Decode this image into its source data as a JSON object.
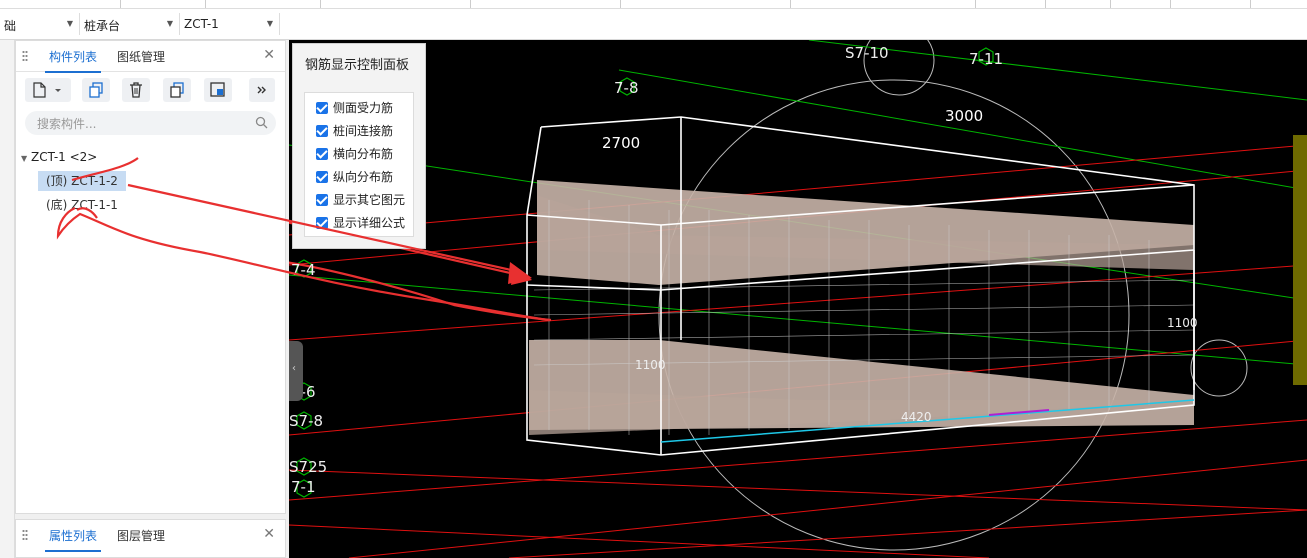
{
  "toolbar": {
    "combos": [
      {
        "value": "础"
      },
      {
        "value": "桩承台"
      },
      {
        "value": "ZCT-1"
      }
    ]
  },
  "component_panel": {
    "tabs": [
      {
        "label": "构件列表"
      },
      {
        "label": "图纸管理"
      }
    ],
    "search_placeholder": "搜索构件...",
    "tree": {
      "root": "ZCT-1 <2>",
      "items": [
        {
          "label": "(顶) ZCT-1-2",
          "selected": true
        },
        {
          "label": "(底) ZCT-1-1",
          "selected": false
        }
      ]
    }
  },
  "property_panel": {
    "tabs": [
      {
        "label": "属性列表"
      },
      {
        "label": "图层管理"
      }
    ]
  },
  "rebar_control": {
    "title": "钢筋显示控制面板",
    "options": [
      {
        "label": "侧面受力筋",
        "checked": true
      },
      {
        "label": "桩间连接筋",
        "checked": true
      },
      {
        "label": "横向分布筋",
        "checked": true
      },
      {
        "label": "纵向分布筋",
        "checked": true
      },
      {
        "label": "显示其它图元",
        "checked": true
      },
      {
        "label": "显示详细公式",
        "checked": true
      }
    ]
  },
  "viewport": {
    "axis_labels": [
      "S7-10",
      "7-11",
      "7-8",
      "7-4",
      "7-6",
      "S7-8",
      "S725",
      "7-1"
    ],
    "dimensions": [
      "2700",
      "3000",
      "1100",
      "1100",
      "4420"
    ]
  },
  "colors": {
    "accent": "#1c6fd1",
    "checkbox": "#1a73e8",
    "axis_green": "#00b400",
    "red_lines": "#e01010",
    "rebar": "#c8b4a8",
    "annotation": "#e83030"
  }
}
